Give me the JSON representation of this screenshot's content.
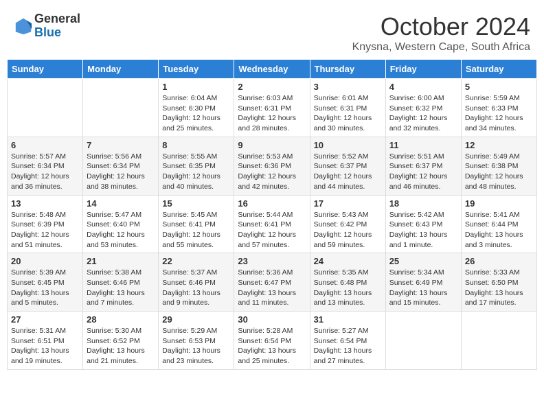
{
  "header": {
    "logo_general": "General",
    "logo_blue": "Blue",
    "month_title": "October 2024",
    "location": "Knysna, Western Cape, South Africa"
  },
  "days_of_week": [
    "Sunday",
    "Monday",
    "Tuesday",
    "Wednesday",
    "Thursday",
    "Friday",
    "Saturday"
  ],
  "weeks": [
    [
      {
        "day": "",
        "info": ""
      },
      {
        "day": "",
        "info": ""
      },
      {
        "day": "1",
        "info": "Sunrise: 6:04 AM\nSunset: 6:30 PM\nDaylight: 12 hours and 25 minutes."
      },
      {
        "day": "2",
        "info": "Sunrise: 6:03 AM\nSunset: 6:31 PM\nDaylight: 12 hours and 28 minutes."
      },
      {
        "day": "3",
        "info": "Sunrise: 6:01 AM\nSunset: 6:31 PM\nDaylight: 12 hours and 30 minutes."
      },
      {
        "day": "4",
        "info": "Sunrise: 6:00 AM\nSunset: 6:32 PM\nDaylight: 12 hours and 32 minutes."
      },
      {
        "day": "5",
        "info": "Sunrise: 5:59 AM\nSunset: 6:33 PM\nDaylight: 12 hours and 34 minutes."
      }
    ],
    [
      {
        "day": "6",
        "info": "Sunrise: 5:57 AM\nSunset: 6:34 PM\nDaylight: 12 hours and 36 minutes."
      },
      {
        "day": "7",
        "info": "Sunrise: 5:56 AM\nSunset: 6:34 PM\nDaylight: 12 hours and 38 minutes."
      },
      {
        "day": "8",
        "info": "Sunrise: 5:55 AM\nSunset: 6:35 PM\nDaylight: 12 hours and 40 minutes."
      },
      {
        "day": "9",
        "info": "Sunrise: 5:53 AM\nSunset: 6:36 PM\nDaylight: 12 hours and 42 minutes."
      },
      {
        "day": "10",
        "info": "Sunrise: 5:52 AM\nSunset: 6:37 PM\nDaylight: 12 hours and 44 minutes."
      },
      {
        "day": "11",
        "info": "Sunrise: 5:51 AM\nSunset: 6:37 PM\nDaylight: 12 hours and 46 minutes."
      },
      {
        "day": "12",
        "info": "Sunrise: 5:49 AM\nSunset: 6:38 PM\nDaylight: 12 hours and 48 minutes."
      }
    ],
    [
      {
        "day": "13",
        "info": "Sunrise: 5:48 AM\nSunset: 6:39 PM\nDaylight: 12 hours and 51 minutes."
      },
      {
        "day": "14",
        "info": "Sunrise: 5:47 AM\nSunset: 6:40 PM\nDaylight: 12 hours and 53 minutes."
      },
      {
        "day": "15",
        "info": "Sunrise: 5:45 AM\nSunset: 6:41 PM\nDaylight: 12 hours and 55 minutes."
      },
      {
        "day": "16",
        "info": "Sunrise: 5:44 AM\nSunset: 6:41 PM\nDaylight: 12 hours and 57 minutes."
      },
      {
        "day": "17",
        "info": "Sunrise: 5:43 AM\nSunset: 6:42 PM\nDaylight: 12 hours and 59 minutes."
      },
      {
        "day": "18",
        "info": "Sunrise: 5:42 AM\nSunset: 6:43 PM\nDaylight: 13 hours and 1 minute."
      },
      {
        "day": "19",
        "info": "Sunrise: 5:41 AM\nSunset: 6:44 PM\nDaylight: 13 hours and 3 minutes."
      }
    ],
    [
      {
        "day": "20",
        "info": "Sunrise: 5:39 AM\nSunset: 6:45 PM\nDaylight: 13 hours and 5 minutes."
      },
      {
        "day": "21",
        "info": "Sunrise: 5:38 AM\nSunset: 6:46 PM\nDaylight: 13 hours and 7 minutes."
      },
      {
        "day": "22",
        "info": "Sunrise: 5:37 AM\nSunset: 6:46 PM\nDaylight: 13 hours and 9 minutes."
      },
      {
        "day": "23",
        "info": "Sunrise: 5:36 AM\nSunset: 6:47 PM\nDaylight: 13 hours and 11 minutes."
      },
      {
        "day": "24",
        "info": "Sunrise: 5:35 AM\nSunset: 6:48 PM\nDaylight: 13 hours and 13 minutes."
      },
      {
        "day": "25",
        "info": "Sunrise: 5:34 AM\nSunset: 6:49 PM\nDaylight: 13 hours and 15 minutes."
      },
      {
        "day": "26",
        "info": "Sunrise: 5:33 AM\nSunset: 6:50 PM\nDaylight: 13 hours and 17 minutes."
      }
    ],
    [
      {
        "day": "27",
        "info": "Sunrise: 5:31 AM\nSunset: 6:51 PM\nDaylight: 13 hours and 19 minutes."
      },
      {
        "day": "28",
        "info": "Sunrise: 5:30 AM\nSunset: 6:52 PM\nDaylight: 13 hours and 21 minutes."
      },
      {
        "day": "29",
        "info": "Sunrise: 5:29 AM\nSunset: 6:53 PM\nDaylight: 13 hours and 23 minutes."
      },
      {
        "day": "30",
        "info": "Sunrise: 5:28 AM\nSunset: 6:54 PM\nDaylight: 13 hours and 25 minutes."
      },
      {
        "day": "31",
        "info": "Sunrise: 5:27 AM\nSunset: 6:54 PM\nDaylight: 13 hours and 27 minutes."
      },
      {
        "day": "",
        "info": ""
      },
      {
        "day": "",
        "info": ""
      }
    ]
  ]
}
